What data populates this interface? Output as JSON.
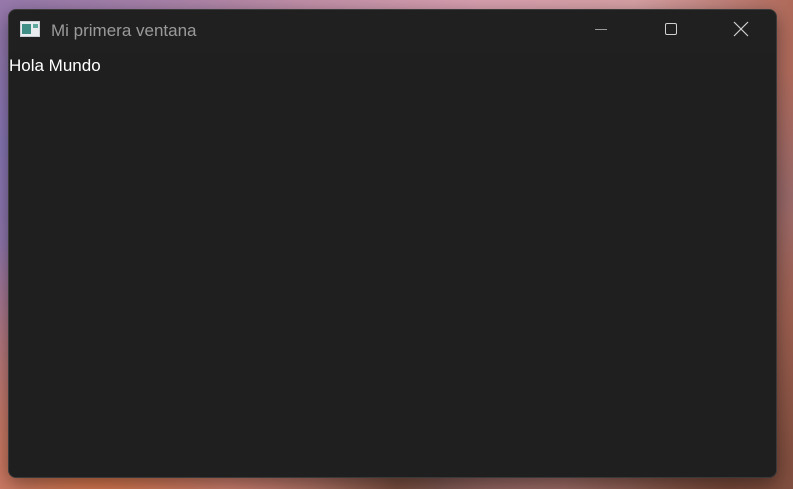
{
  "window": {
    "title": "Mi primera ventana",
    "app_icon": "app-window-icon",
    "controls": {
      "minimize_icon": "minimize-icon",
      "maximize_icon": "maximize-icon",
      "close_icon": "close-icon"
    }
  },
  "content": {
    "label": "Hola Mundo"
  },
  "colors": {
    "window_bg": "#1f1f1f",
    "title_text": "#9a9a9a",
    "content_text": "#ffffff"
  }
}
